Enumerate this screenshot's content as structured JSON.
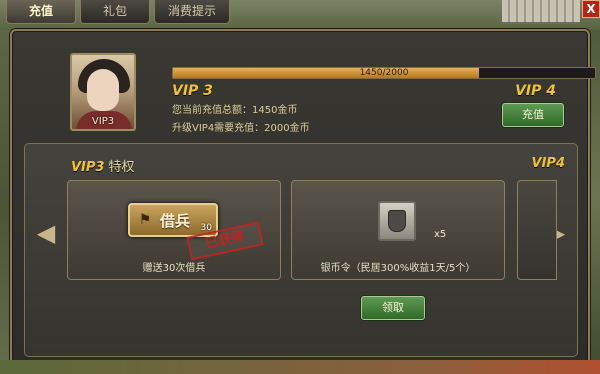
{
  "tabs": [
    {
      "label": "充值",
      "active": true
    },
    {
      "label": "礼包",
      "active": false
    },
    {
      "label": "消费提示",
      "active": false
    }
  ],
  "close_label": "X",
  "vip": {
    "portrait_label": "VIP3",
    "progress_text": "1450/2000",
    "progress_fraction": 0.725,
    "current_level": "VIP 3",
    "next_level": "VIP 4",
    "total_recharge": "您当前充值总额：1450金币",
    "upgrade_need": "升级VIP4需要充值：2000金币",
    "recharge_button": "充值"
  },
  "privilege": {
    "header_level": "VIP3",
    "header_text": "特权",
    "next_level": "VIP4",
    "cards": [
      {
        "item_name": "借兵",
        "item_count": "30",
        "stamp": "已获得",
        "desc": "赠送30次借兵"
      },
      {
        "item_count": "x5",
        "desc": "银币令（民居300%收益1天/5个）"
      }
    ],
    "claim_button": "领取"
  },
  "colors": {
    "gold": "#f0c236",
    "text": "#dccc98",
    "green": "#2f6a29",
    "stamp_red": "#c1251d"
  },
  "icons": {
    "left": "arrow-left-icon",
    "right": "arrow-right-icon",
    "item": "flag-icon",
    "token": "silver-token-icon"
  }
}
